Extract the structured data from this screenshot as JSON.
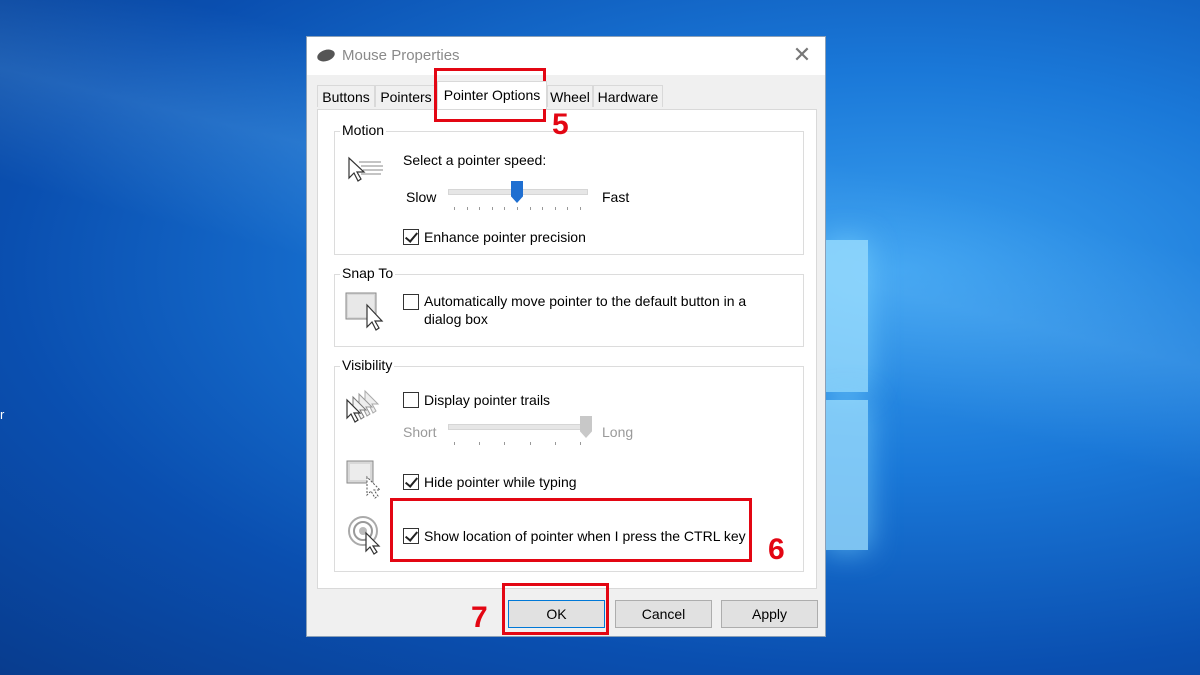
{
  "desktop": {
    "edge_char": "r"
  },
  "dialog": {
    "title": "Mouse Properties",
    "close_glyph": "✕",
    "tabs": [
      "Buttons",
      "Pointers",
      "Pointer Options",
      "Wheel",
      "Hardware"
    ],
    "active_tab": "Pointer Options",
    "motion": {
      "group_label": "Motion",
      "speed_label": "Select a pointer speed:",
      "slow_label": "Slow",
      "fast_label": "Fast",
      "speed_value": 0.5,
      "precision_label": "Enhance pointer precision",
      "precision_checked": true
    },
    "snap_to": {
      "group_label": "Snap To",
      "auto_move_label": "Automatically move pointer to the default button in a dialog box",
      "auto_move_checked": false
    },
    "visibility": {
      "group_label": "Visibility",
      "trails_label": "Display pointer trails",
      "trails_checked": false,
      "short_label": "Short",
      "long_label": "Long",
      "trails_value": 1.0,
      "hide_typing_label": "Hide pointer while typing",
      "hide_typing_checked": true,
      "show_location_label": "Show location of pointer when I press the CTRL key",
      "show_location_checked": true
    },
    "buttons": {
      "ok": "OK",
      "cancel": "Cancel",
      "apply": "Apply"
    }
  },
  "annotations": {
    "tab_step": "5",
    "ctrl_step": "6",
    "ok_step": "7",
    "color": "#e30613"
  }
}
